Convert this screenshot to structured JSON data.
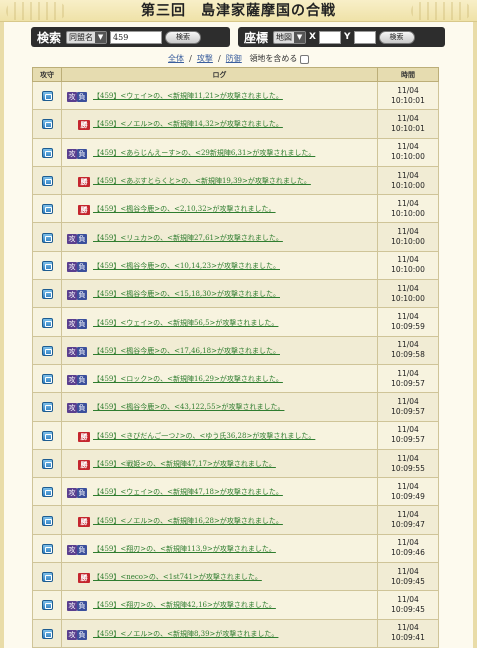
{
  "header": {
    "title": "第三回　島津家薩摩国の合戦"
  },
  "search": {
    "label": "検索",
    "select_value": "同盟名",
    "input_value": "459",
    "button": "検索"
  },
  "coords": {
    "label": "座標",
    "select_value": "地図",
    "x_label": "X",
    "y_label": "Y",
    "x_value": "",
    "y_value": "",
    "button": "検索"
  },
  "filters": {
    "all": "全体",
    "sep1": "/",
    "attack": "攻撃",
    "sep2": "/",
    "defense": "防御",
    "include_land": "領地を含める"
  },
  "table": {
    "headers": {
      "attack_defense": "攻守",
      "log": "ログ",
      "time": "時間"
    },
    "badge_attack": "攻",
    "badge_lose": "負",
    "badge_win": "勝",
    "rows": [
      {
        "result": "lose",
        "log": "【459】<ウェイ>の、<新規陣11,21>が攻撃されました。",
        "date": "11/04",
        "time": "10:10:01"
      },
      {
        "result": "win",
        "log": "【459】<ノエル>の、<新規陣14,32>が攻撃されました。",
        "date": "11/04",
        "time": "10:10:01"
      },
      {
        "result": "lose",
        "log": "【459】<あらじんえーす>の、<29新規陣6,31>が攻撃されました。",
        "date": "11/04",
        "time": "10:10:00"
      },
      {
        "result": "win",
        "log": "【459】<あぶすとらくと>の、<新規陣19,39>が攻撃されました。",
        "date": "11/04",
        "time": "10:10:00"
      },
      {
        "result": "win",
        "log": "【459】<楓谷今鹿>の、<2,10,32>が攻撃されました。",
        "date": "11/04",
        "time": "10:10:00"
      },
      {
        "result": "lose",
        "log": "【459】<リュカ>の、<新規陣27,61>が攻撃されました。",
        "date": "11/04",
        "time": "10:10:00"
      },
      {
        "result": "lose",
        "log": "【459】<楓谷今鹿>の、<10,14,23>が攻撃されました。",
        "date": "11/04",
        "time": "10:10:00"
      },
      {
        "result": "lose",
        "log": "【459】<楓谷今鹿>の、<15,18,30>が攻撃されました。",
        "date": "11/04",
        "time": "10:10:00"
      },
      {
        "result": "lose",
        "log": "【459】<ウェイ>の、<新規陣56,5>が攻撃されました。",
        "date": "11/04",
        "time": "10:09:59"
      },
      {
        "result": "lose",
        "log": "【459】<楓谷今鹿>の、<17,46,18>が攻撃されました。",
        "date": "11/04",
        "time": "10:09:58"
      },
      {
        "result": "lose",
        "log": "【459】<ロック>の、<新規陣16,29>が攻撃されました。",
        "date": "11/04",
        "time": "10:09:57"
      },
      {
        "result": "lose",
        "log": "【459】<楓谷今鹿>の、<43,122,55>が攻撃されました。",
        "date": "11/04",
        "time": "10:09:57"
      },
      {
        "result": "win",
        "log": "【459】<きびだんご一つ♪>の、<ゆう氏36,28>が攻撃されました。",
        "date": "11/04",
        "time": "10:09:57"
      },
      {
        "result": "win",
        "log": "【459】<戦姫>の、<新規陣47,17>が攻撃されました。",
        "date": "11/04",
        "time": "10:09:55"
      },
      {
        "result": "lose",
        "log": "【459】<ウェイ>の、<新規陣47,18>が攻撃されました。",
        "date": "11/04",
        "time": "10:09:49"
      },
      {
        "result": "win",
        "log": "【459】<ノエル>の、<新規陣16,28>が攻撃されました。",
        "date": "11/04",
        "time": "10:09:47"
      },
      {
        "result": "lose",
        "log": "【459】<翔刃>の、<新規陣113,9>が攻撃されました。",
        "date": "11/04",
        "time": "10:09:46"
      },
      {
        "result": "win",
        "log": "【459】<neco>の、<1st741>が攻撃されました。",
        "date": "11/04",
        "time": "10:09:45"
      },
      {
        "result": "lose",
        "log": "【459】<翔刃>の、<新規陣42,16>が攻撃されました。",
        "date": "11/04",
        "time": "10:09:45"
      },
      {
        "result": "lose",
        "log": "【459】<ノエル>の、<新規陣8,39>が攻撃されました。",
        "date": "11/04",
        "time": "10:09:41"
      }
    ]
  }
}
